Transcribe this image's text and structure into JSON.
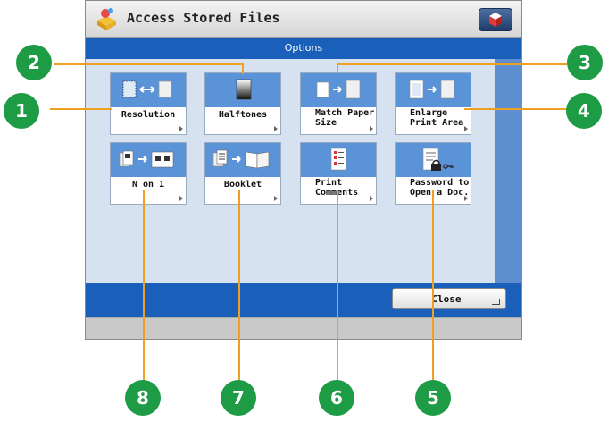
{
  "window": {
    "title": "Access Stored Files",
    "section": "Options"
  },
  "buttons": [
    {
      "label": "Resolution",
      "icon": "resolution-icon"
    },
    {
      "label": "Halftones",
      "icon": "halftones-icon"
    },
    {
      "label": "Match Paper Size",
      "icon": "match-paper-size-icon"
    },
    {
      "label": "Enlarge Print Area",
      "icon": "enlarge-print-area-icon"
    },
    {
      "label": "N on 1",
      "icon": "n-on-1-icon"
    },
    {
      "label": "Booklet",
      "icon": "booklet-icon"
    },
    {
      "label": "Print Comments",
      "icon": "print-comments-icon"
    },
    {
      "label": "Password to Open a Doc.",
      "icon": "password-doc-icon"
    }
  ],
  "close_label": "Close",
  "callouts": [
    "1",
    "2",
    "3",
    "4",
    "5",
    "6",
    "7",
    "8"
  ],
  "colors": {
    "accent_blue": "#1a5fb9",
    "callout_green": "#1d9c45",
    "leader_orange": "#f0a020"
  }
}
